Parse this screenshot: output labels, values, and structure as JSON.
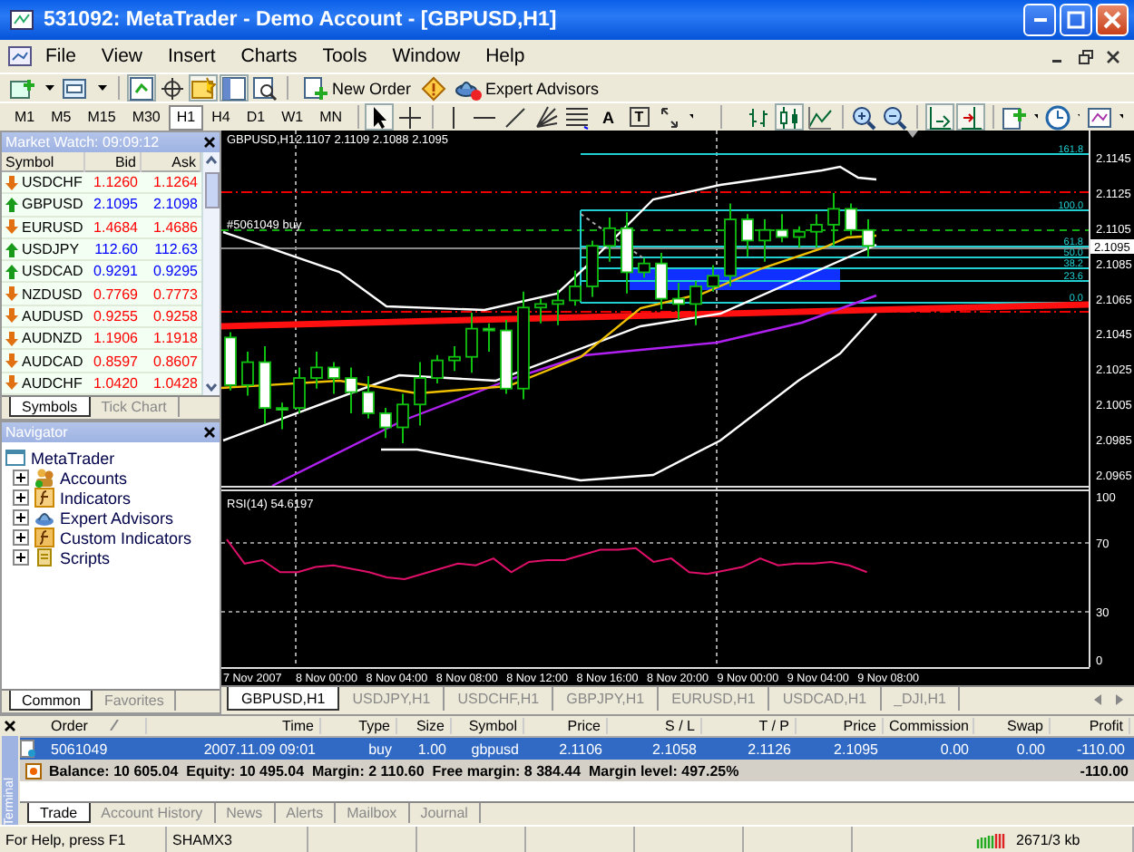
{
  "window": {
    "title": "531092: MetaTrader - Demo Account - [GBPUSD,H1]"
  },
  "menu": [
    "File",
    "View",
    "Insert",
    "Charts",
    "Tools",
    "Window",
    "Help"
  ],
  "toolbar": {
    "new_order": "New Order",
    "expert_advisors": "Expert Advisors",
    "text_tool": "A",
    "label_tool": "T"
  },
  "timeframes": [
    {
      "label": "M1",
      "selected": false
    },
    {
      "label": "M5",
      "selected": false
    },
    {
      "label": "M15",
      "selected": false
    },
    {
      "label": "M30",
      "selected": false
    },
    {
      "label": "H1",
      "selected": true
    },
    {
      "label": "H4",
      "selected": false
    },
    {
      "label": "D1",
      "selected": false
    },
    {
      "label": "W1",
      "selected": false
    },
    {
      "label": "MN",
      "selected": false
    }
  ],
  "market_watch": {
    "title": "Market Watch: 09:09:12",
    "columns": [
      "Symbol",
      "Bid",
      "Ask"
    ],
    "rows": [
      {
        "symbol": "USDCHF",
        "bid": "1.1260",
        "ask": "1.1264",
        "rising": false
      },
      {
        "symbol": "GBPUSD",
        "bid": "2.1095",
        "ask": "2.1098",
        "rising": true
      },
      {
        "symbol": "EURUSD",
        "bid": "1.4684",
        "ask": "1.4686",
        "rising": false
      },
      {
        "symbol": "USDJPY",
        "bid": "112.60",
        "ask": "112.63",
        "rising": true
      },
      {
        "symbol": "USDCAD",
        "bid": "0.9291",
        "ask": "0.9295",
        "rising": true
      },
      {
        "symbol": "NZDUSD",
        "bid": "0.7769",
        "ask": "0.7773",
        "rising": false
      },
      {
        "symbol": "AUDUSD",
        "bid": "0.9255",
        "ask": "0.9258",
        "rising": false
      },
      {
        "symbol": "AUDNZD",
        "bid": "1.1906",
        "ask": "1.1918",
        "rising": false
      },
      {
        "symbol": "AUDCAD",
        "bid": "0.8597",
        "ask": "0.8607",
        "rising": false
      },
      {
        "symbol": "AUDCHF",
        "bid": "1.0420",
        "ask": "1.0428",
        "rising": false
      }
    ],
    "tabs": [
      {
        "label": "Symbols",
        "selected": true
      },
      {
        "label": "Tick Chart",
        "selected": false
      }
    ]
  },
  "navigator": {
    "title": "Navigator",
    "root": "MetaTrader",
    "items": [
      {
        "label": "Accounts",
        "kind": "accounts",
        "expanded": false
      },
      {
        "label": "Indicators",
        "kind": "indicators",
        "expanded": false
      },
      {
        "label": "Expert Advisors",
        "kind": "experts",
        "expanded": false
      },
      {
        "label": "Custom Indicators",
        "kind": "custom",
        "expanded": false
      },
      {
        "label": "Scripts",
        "kind": "scripts",
        "expanded": false
      }
    ],
    "tabs": [
      {
        "label": "Common",
        "selected": true
      },
      {
        "label": "Favorites",
        "selected": false
      }
    ]
  },
  "chart": {
    "symbol": "GBPUSD,H1",
    "ohlc": "2.1107 2.1109 2.1088 2.1095",
    "order_label": "#5061049 buy",
    "price_labels": [
      "2.1145",
      "2.1125",
      "2.1105",
      "2.1085",
      "2.1065",
      "2.1045",
      "2.1025",
      "2.1005",
      "2.0985",
      "2.0965"
    ],
    "current_price": "2.1095",
    "fib_levels": [
      "161.8",
      "100.0",
      "61.8",
      "50.0",
      "38.2",
      "23.6",
      "0.0"
    ],
    "rsi_label": "RSI(14) 54.6197",
    "rsi_levels": [
      "100",
      "70",
      "30",
      "0"
    ],
    "time_labels": [
      "7 Nov 2007",
      "8 Nov 00:00",
      "8 Nov 04:00",
      "8 Nov 08:00",
      "8 Nov 12:00",
      "8 Nov 16:00",
      "8 Nov 20:00",
      "9 Nov 00:00",
      "9 Nov 04:00",
      "9 Nov 08:00"
    ],
    "tabs": [
      {
        "label": "GBPUSD,H1",
        "selected": true
      },
      {
        "label": "USDJPY,H1",
        "selected": false
      },
      {
        "label": "USDCHF,H1",
        "selected": false
      },
      {
        "label": "GBPJPY,H1",
        "selected": false
      },
      {
        "label": "EURUSD,H1",
        "selected": false
      },
      {
        "label": "USDCAD,H1",
        "selected": false
      },
      {
        "label": "_DJI,H1",
        "selected": false
      }
    ]
  },
  "terminal": {
    "side_label": "Terminal",
    "columns": [
      "Order",
      "Time",
      "Type",
      "Size",
      "Symbol",
      "Price",
      "S / L",
      "T / P",
      "Price",
      "Commission",
      "Swap",
      "Profit"
    ],
    "rows": [
      {
        "cells": [
          "5061049",
          "2007.11.09 09:01",
          "buy",
          "1.00",
          "gbpusd",
          "2.1106",
          "2.1058",
          "2.1126",
          "2.1095",
          "0.00",
          "0.00",
          "-110.00"
        ],
        "selected": true
      }
    ],
    "summary": "Balance: 10 605.04  Equity: 10 495.04  Margin: 2 110.60  Free margin: 8 384.44  Margin level: 497.25%",
    "summary_profit": "-110.00",
    "tabs": [
      {
        "label": "Trade",
        "selected": true
      },
      {
        "label": "Account History",
        "selected": false
      },
      {
        "label": "News",
        "selected": false
      },
      {
        "label": "Alerts",
        "selected": false
      },
      {
        "label": "Mailbox",
        "selected": false
      },
      {
        "label": "Journal",
        "selected": false
      }
    ]
  },
  "status_bar": {
    "help": "For Help, press F1",
    "profile": "SHAMX3",
    "traffic": "2671/3 kb"
  }
}
